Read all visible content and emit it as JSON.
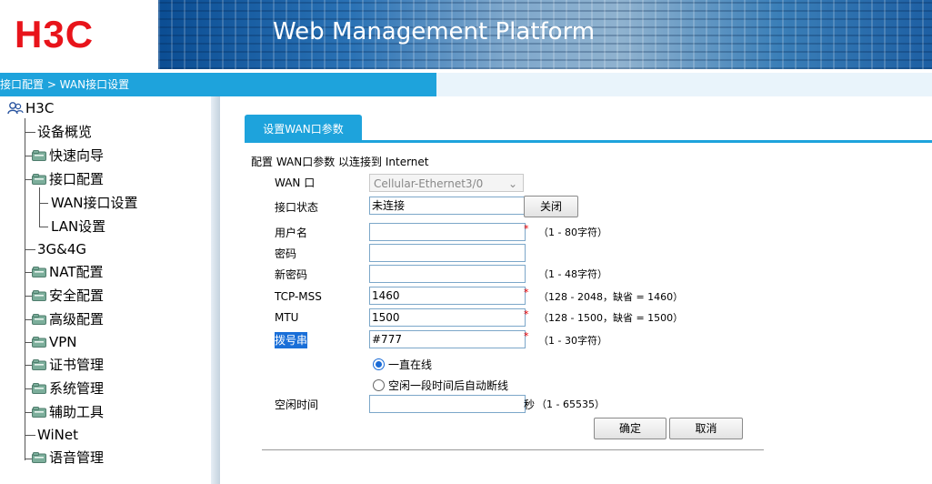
{
  "header": {
    "logo": "H3C",
    "title": "Web Management Platform"
  },
  "breadcrumb": "接口配置 > WAN接口设置",
  "sidebar": {
    "root": "H3C",
    "items": [
      {
        "label": "设备概览",
        "folder": false
      },
      {
        "label": "快速向导",
        "folder": true
      },
      {
        "label": "接口配置",
        "folder": true
      },
      {
        "label": "WAN接口设置",
        "folder": false
      },
      {
        "label": "LAN设置",
        "folder": false
      },
      {
        "label": "3G&4G",
        "folder": false
      },
      {
        "label": "NAT配置",
        "folder": true
      },
      {
        "label": "安全配置",
        "folder": true
      },
      {
        "label": "高级配置",
        "folder": true
      },
      {
        "label": "VPN",
        "folder": true
      },
      {
        "label": "证书管理",
        "folder": true
      },
      {
        "label": "系统管理",
        "folder": true
      },
      {
        "label": "辅助工具",
        "folder": true
      },
      {
        "label": "WiNet",
        "folder": false
      },
      {
        "label": "语音管理",
        "folder": true
      }
    ]
  },
  "tab": {
    "label": "设置WAN口参数"
  },
  "form": {
    "description": "配置 WAN口参数 以连接到 Internet",
    "wan_label": "WAN 口",
    "wan_value": "Cellular-Ethernet3/0",
    "status_label": "接口状态",
    "status_value": "未连接",
    "close_button": "关闭",
    "username_label": "用户名",
    "username_value": "",
    "username_hint": "（1 - 80字符）",
    "password_label": "密码",
    "password_value": "",
    "new_password_label": "新密码",
    "new_password_value": "",
    "new_password_hint": "（1 - 48字符）",
    "mss_label": "TCP-MSS",
    "mss_value": "1460",
    "mss_hint": "（128 - 2048，缺省 = 1460）",
    "mtu_label": "MTU",
    "mtu_value": "1500",
    "mtu_hint": "（128 - 1500，缺省 = 1500）",
    "dial_label": "拨号串",
    "dial_value": "#777",
    "dial_hint": "（1 - 30字符）",
    "radio_always": "一直在线",
    "radio_idle": "空闲一段时间后自动断线",
    "idle_label": "空闲时间",
    "idle_value": "",
    "idle_unit": "秒",
    "idle_hint": "（1 - 65535）",
    "ok_button": "确定",
    "cancel_button": "取消",
    "required_mark": "*"
  },
  "colors": {
    "accent": "#1ea3dc",
    "logo": "#e8141b",
    "required": "#ee0000"
  }
}
